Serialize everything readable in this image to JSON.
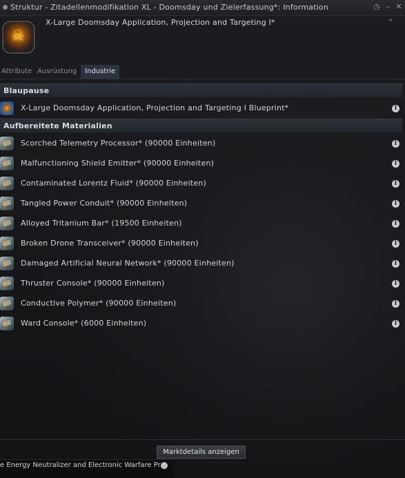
{
  "window": {
    "title": "Struktur - Zitadellenmodifikation XL - Doomsday und Zielerfassung*: Information",
    "item_title": "X-Large Doomsday Application, Projection and Targeting I*",
    "controls": [
      "◷",
      "–",
      "✕"
    ]
  },
  "tabs": [
    {
      "label": "Attribute",
      "active": false
    },
    {
      "label": "Ausrüstung",
      "active": false
    },
    {
      "label": "Industrie",
      "active": true
    }
  ],
  "sections": {
    "blueprint_header": "Blaupause",
    "materials_header": "Aufbereitete Materialien"
  },
  "blueprint": {
    "label": "X-Large Doomsday Application, Projection and Targeting I Blueprint*"
  },
  "materials": [
    {
      "label": "Scorched Telemetry Processor* (90000 Einheiten)"
    },
    {
      "label": "Malfunctioning Shield Emitter* (90000 Einheiten)"
    },
    {
      "label": "Contaminated Lorentz Fluid* (90000 Einheiten)"
    },
    {
      "label": "Tangled Power Conduit* (90000 Einheiten)"
    },
    {
      "label": "Alloyed Tritanium Bar* (19500 Einheiten)"
    },
    {
      "label": "Broken Drone Transceiver* (90000 Einheiten)"
    },
    {
      "label": "Damaged Artificial Neural Network* (90000 Einheiten)"
    },
    {
      "label": "Thruster Console* (90000 Einheiten)"
    },
    {
      "label": "Conductive Polymer* (90000 Einheiten)"
    },
    {
      "label": "Ward Console* (6000 Einheiten)"
    }
  ],
  "info_glyph": "i",
  "footer": {
    "market_button": "Marktdetails anzeigen"
  },
  "background_window": {
    "line1": "e Energy Neutralizer and Electronic Warfare Pr"
  },
  "colors": {
    "accent_tab": "#2b3440",
    "section_bg": "#2b3138",
    "background": "#131416"
  }
}
